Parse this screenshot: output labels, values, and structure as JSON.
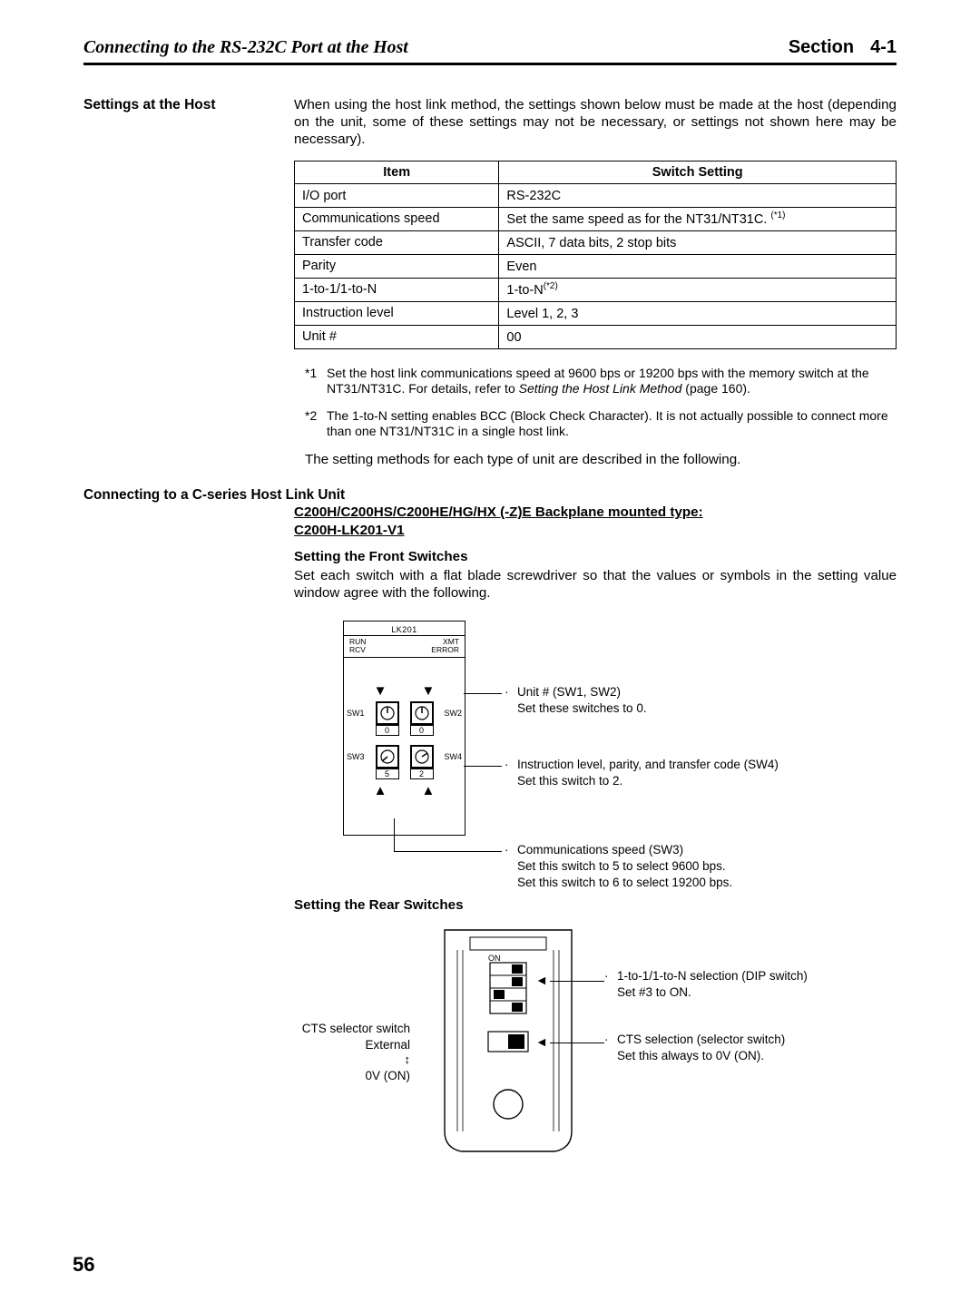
{
  "header": {
    "left": "Connecting to the RS-232C Port at the Host",
    "section_label": "Section",
    "section_num": "4-1"
  },
  "side_label": "Settings at the Host",
  "intro": "When using the host link method, the settings shown below must be made at the host (depending on the unit, some of these settings may not be necessary, or settings not shown here may be necessary).",
  "table": {
    "headers": {
      "item": "Item",
      "setting": "Switch Setting"
    },
    "rows": [
      {
        "item": "I/O port",
        "setting": "RS-232C",
        "sup": ""
      },
      {
        "item": "Communications speed",
        "setting": "Set the same speed as for the NT31/NT31C. ",
        "sup": "(*1)"
      },
      {
        "item": "Transfer code",
        "setting": "ASCII, 7 data bits, 2 stop bits",
        "sup": ""
      },
      {
        "item": "Parity",
        "setting": "Even",
        "sup": ""
      },
      {
        "item": "1-to-1/1-to-N",
        "setting": "1-to-N",
        "sup": "(*2)"
      },
      {
        "item": "Instruction level",
        "setting": "Level 1, 2, 3",
        "sup": ""
      },
      {
        "item": "Unit #",
        "setting": "00",
        "sup": ""
      }
    ]
  },
  "footnotes": {
    "f1_marker": "*1",
    "f1_a": "Set the host link communications speed at 9600 bps or 19200 bps with the memory switch at the NT31/NT31C. For details, refer to ",
    "f1_i": "Setting the Host Link Method",
    "f1_b": " (page 160).",
    "f2_marker": "*2",
    "f2": "The 1-to-N setting enables BCC (Block Check Character). It is not actually possible to connect more than one NT31/NT31C in a single host link."
  },
  "final_line": "The setting methods for each type of unit are described in the following.",
  "sub": {
    "h1": "Connecting to a C-series Host Link Unit",
    "h2a": "C200H/C200HS/C200HE/HG/HX (-Z)E Backplane mounted type: ",
    "h2b": "C200H-LK201-V1",
    "h3": "Setting the Front Switches",
    "text": "Set each switch with a flat blade screwdriver so that the values or symbols in the setting value window agree with the following."
  },
  "diagram1": {
    "panel_title": "LK201",
    "ind_left1": "RUN",
    "ind_left2": "RCV",
    "ind_right1": "XMT",
    "ind_right2": "ERROR",
    "sw1": "SW1",
    "sw2": "SW2",
    "sw3": "SW3",
    "sw4": "SW4",
    "sw1_val": "0",
    "sw2_val": "0",
    "sw3_val": "5",
    "sw4_val": "2",
    "c1a": "Unit # (SW1, SW2)",
    "c1b": "Set these switches to 0.",
    "c2a": "Instruction level, parity, and transfer code (SW4)",
    "c2b": "Set this switch to 2.",
    "c3a": "Communications speed (SW3)",
    "c3b": "Set this switch to 5 to select 9600 bps.",
    "c3c": "Set this switch to 6 to select 19200 bps."
  },
  "sub2": {
    "h3": "Setting the Rear Switches"
  },
  "diagram2": {
    "on_label": "ON",
    "left1": "CTS selector switch",
    "left2": "External",
    "left3": "0V (ON)",
    "r1a": "1-to-1/1-to-N selection (DIP switch)",
    "r1b": "Set #3 to ON.",
    "r2a": "CTS selection (selector switch)",
    "r2b": "Set this always to 0V (ON)."
  },
  "page_number": "56"
}
